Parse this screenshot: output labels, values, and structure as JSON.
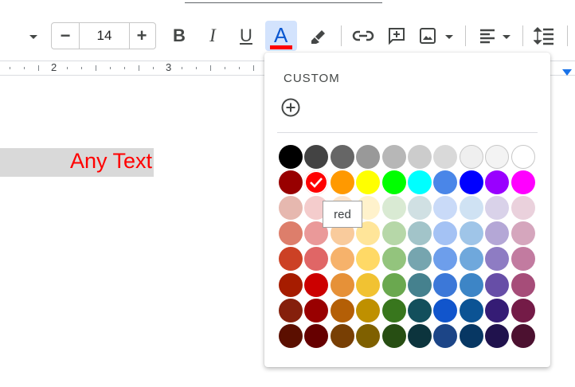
{
  "toolbar": {
    "font_size": "14",
    "bold_label": "B",
    "italic_label": "I",
    "underline_label": "U",
    "text_color_label": "A",
    "current_text_color": "#ff0000"
  },
  "ruler": {
    "marks": [
      "2",
      "3"
    ]
  },
  "document": {
    "text": "Any Text",
    "text_color": "#ff0000",
    "highlight": "#d9d9d9"
  },
  "palette": {
    "custom_label": "CUSTOM",
    "selected_color": "red",
    "tooltip": "red",
    "rows": [
      [
        "#000000",
        "#434343",
        "#666666",
        "#999999",
        "#b7b7b7",
        "#cccccc",
        "#d9d9d9",
        "#efefef",
        "#f3f3f3",
        "#ffffff"
      ],
      [
        "#980000",
        "#ff0000",
        "#ff9900",
        "#ffff00",
        "#00ff00",
        "#00ffff",
        "#4a86e8",
        "#0000ff",
        "#9900ff",
        "#ff00ff"
      ],
      [
        "#e6b8af",
        "#f4cccc",
        "#fce5cd",
        "#fff2cc",
        "#d9ead3",
        "#d0e0e3",
        "#c9daf8",
        "#cfe2f3",
        "#d9d2e9",
        "#ead1dc"
      ],
      [
        "#dd7e6b",
        "#ea9999",
        "#f9cb9c",
        "#ffe599",
        "#b6d7a8",
        "#a2c4c9",
        "#a4c2f4",
        "#9fc5e8",
        "#b4a7d6",
        "#d5a6bd"
      ],
      [
        "#cc4125",
        "#e06666",
        "#f6b26b",
        "#ffd966",
        "#93c47d",
        "#76a5af",
        "#6d9eeb",
        "#6fa8dc",
        "#8e7cc3",
        "#c27ba0"
      ],
      [
        "#a61c00",
        "#cc0000",
        "#e69138",
        "#f1c232",
        "#6aa84f",
        "#45818e",
        "#3c78d8",
        "#3d85c6",
        "#674ea7",
        "#a64d79"
      ],
      [
        "#85200c",
        "#990000",
        "#b45f06",
        "#bf9000",
        "#38761d",
        "#134f5c",
        "#1155cc",
        "#0b5394",
        "#351c75",
        "#741b47"
      ],
      [
        "#5b0f00",
        "#660000",
        "#783f04",
        "#7f6000",
        "#274e13",
        "#0c343d",
        "#1c4587",
        "#073763",
        "#20124d",
        "#4c1130"
      ]
    ]
  }
}
